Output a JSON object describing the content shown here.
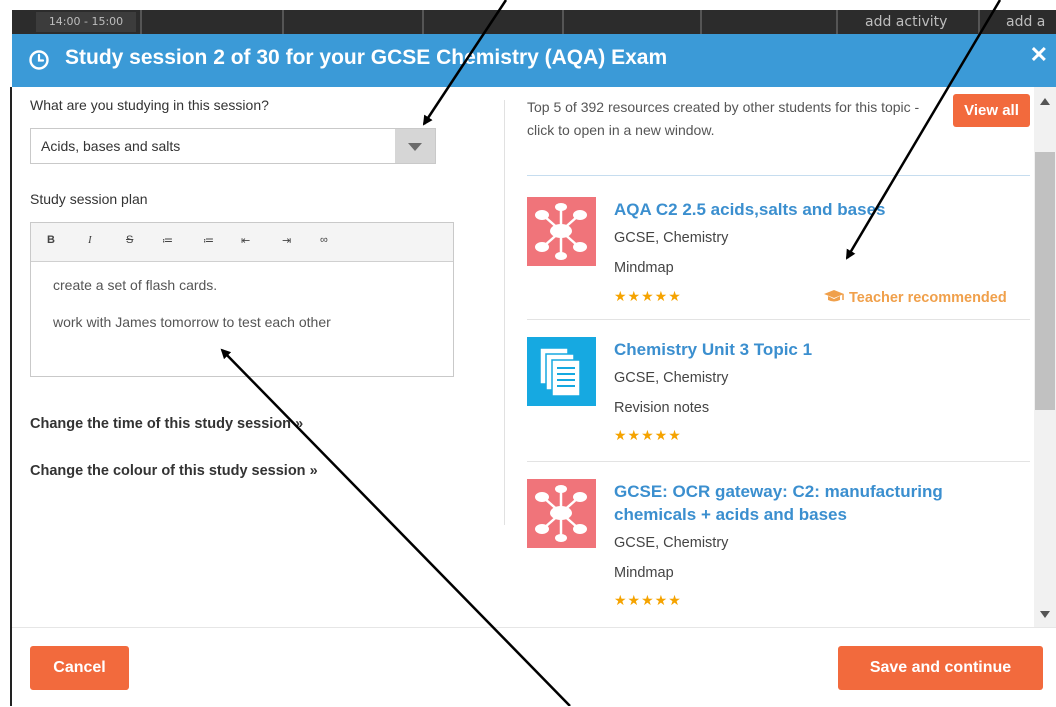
{
  "background": {
    "time_slot": "14:00 - 15:00",
    "add_activity_1": "add activity",
    "add_activity_2": "add a"
  },
  "dialog": {
    "title": "Study session 2 of 30 for your GCSE Chemistry (AQA) Exam",
    "close_label": "✕",
    "studying_label": "What are you studying in this session?",
    "topic_value": "Acids, bases and salts",
    "plan_label": "Study session plan",
    "toolbar": {
      "bold": "B",
      "italic": "I",
      "strike": "S",
      "bullets": "≔",
      "numbered": "≔",
      "outdent": "⇤",
      "indent": "⇥",
      "link": "∞"
    },
    "plan_lines": [
      "create a set of flash cards.",
      "work with James tomorrow to test each other"
    ],
    "change_time_link": "Change the time of this study session »",
    "change_colour_link": "Change the colour of this study session »",
    "resources_intro": "Top 5 of 392 resources created by other students for this topic - click to open in a new window.",
    "view_all_label": "View all",
    "resources": [
      {
        "title": "AQA C2 2.5 acids,salts and bases",
        "subject": "GCSE, Chemistry",
        "type": "Mindmap",
        "stars": "★★★★★",
        "badge": "Teacher recommended",
        "icon": "mindmap-icon"
      },
      {
        "title": "Chemistry Unit 3 Topic 1",
        "subject": "GCSE, Chemistry",
        "type": "Revision notes",
        "stars": "★★★★★",
        "icon": "revision-notes-icon"
      },
      {
        "title": "GCSE: OCR gateway: C2: manufacturing chemicals + acids and bases",
        "subject": "GCSE, Chemistry",
        "type": "Mindmap",
        "stars": "★★★★★",
        "icon": "mindmap-icon"
      }
    ],
    "cancel_label": "Cancel",
    "save_label": "Save and continue"
  },
  "colors": {
    "header": "#3b9ad7",
    "accent_button": "#f26a3d",
    "link_blue": "#3b8fcf",
    "star": "#f5a300",
    "teacher_badge": "#f0a04b"
  }
}
